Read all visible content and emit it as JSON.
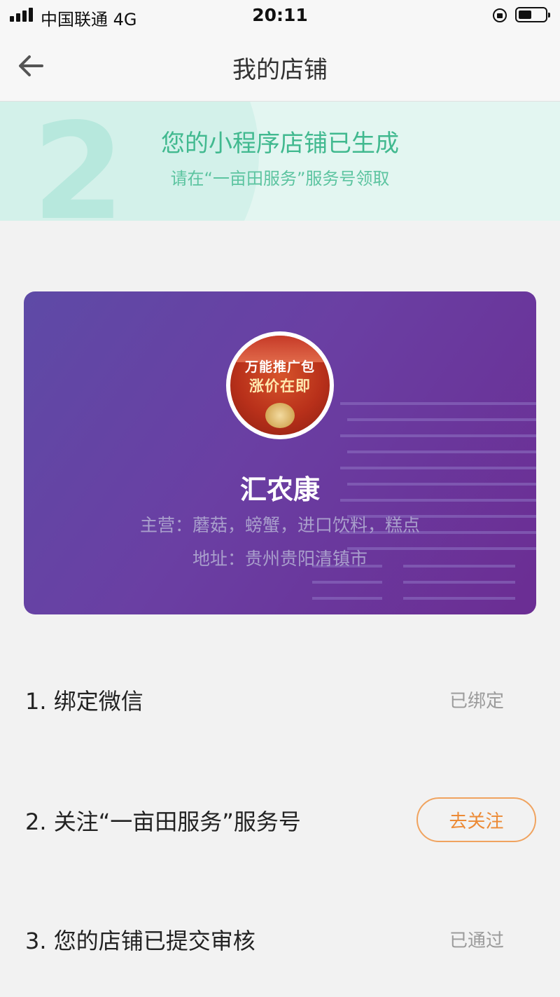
{
  "status_bar": {
    "carrier": "中国联通  4G",
    "time": "20:11"
  },
  "nav": {
    "title": "我的店铺"
  },
  "banner": {
    "step_number": "2",
    "title": "您的小程序店铺已生成",
    "subtitle": "请在“一亩田服务”服务号领取"
  },
  "shop": {
    "avatar_line1": "万能推广包",
    "avatar_line2": "涨价在即",
    "name": "汇农康",
    "main_business": "主营：蘑菇，螃蟹，进口饮料，糕点",
    "address": "地址：贵州贵阳清镇市"
  },
  "steps": [
    {
      "label": "1. 绑定微信",
      "status": "已绑定"
    },
    {
      "label": "2. 关注“一亩田服务”服务号",
      "action": "去关注"
    },
    {
      "label": "3. 您的店铺已提交审核",
      "status": "已通过"
    }
  ],
  "colors": {
    "accent_green": "#41b98f",
    "card_purple": "#6a3fa3",
    "action_orange": "#ec8a35"
  }
}
